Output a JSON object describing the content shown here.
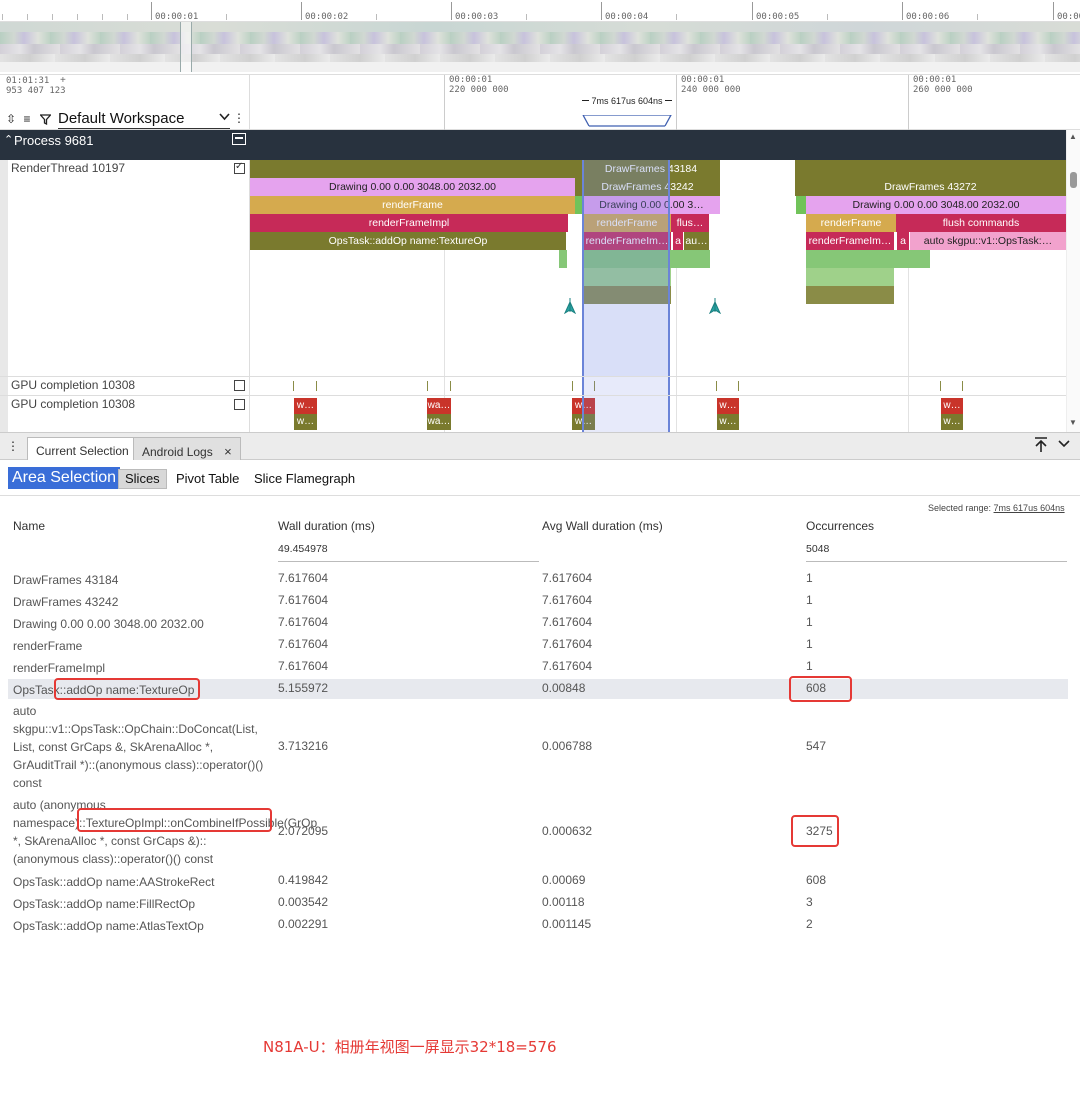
{
  "overview": {
    "time_labels": [
      "00:00:01",
      "00:00:02",
      "00:00:03",
      "00:00:04",
      "00:00:05",
      "00:00:06",
      "00:00"
    ]
  },
  "header": {
    "origin_time": "01:01:31",
    "origin_ns": "953 407 123",
    "plus": "+",
    "workspace": "Default Workspace",
    "time_marks": [
      {
        "t": "00:00:01",
        "ns": "220 000 000"
      },
      {
        "t": "00:00:01",
        "ns": "240 000 000"
      },
      {
        "t": "00:00:01",
        "ns": "260 000 000"
      }
    ],
    "selection_label": "7ms 617us 604ns"
  },
  "process": {
    "title": "Process 9681"
  },
  "tracks": {
    "render_thread": "RenderThread 10197",
    "gpu1": "GPU completion 10308",
    "gpu2": "GPU completion 10308"
  },
  "slices": {
    "drawframes_a": "DrawFrames 43184",
    "drawframes_b": "DrawFrames 43242",
    "drawframes_c": "DrawFrames 43272",
    "drawing_a": "Drawing  0.00  0.00 3048.00 2032.00",
    "drawing_b": "Drawing  0.00  0.00 3…",
    "drawing_c": "Drawing  0.00  0.00 3048.00 2032.00",
    "renderframe": "renderFrame",
    "renderframe_impl": "renderFrameImpl",
    "renderframe_impl_short": "renderFrameIm…",
    "flush": "flus…",
    "flush_commands": "flush commands",
    "opstask": "OpsTask::addOp name:TextureOp",
    "a": "a",
    "au": "au…",
    "auto_skgpu": "auto skgpu::v1::OpsTask:…",
    "gpu_w": "w…",
    "gpu_wa": "wa…"
  },
  "panel": {
    "tab_current": "Current Selection",
    "tab_logs": "Android Logs",
    "close": "×"
  },
  "area": {
    "title": "Area Selection",
    "tabs": [
      "Slices",
      "Pivot Table",
      "Slice Flamegraph"
    ],
    "range_prefix": "Selected range: ",
    "range_value": "7ms 617us 604ns"
  },
  "table": {
    "columns": [
      "Name",
      "Wall duration (ms)",
      "Avg Wall duration (ms)",
      "Occurrences"
    ],
    "totals": {
      "wall": "49.454978",
      "occ": "5048"
    },
    "rows": [
      {
        "name": "DrawFrames 43184",
        "wall": "7.617604",
        "avg": "7.617604",
        "occ": "1"
      },
      {
        "name": "DrawFrames 43242",
        "wall": "7.617604",
        "avg": "7.617604",
        "occ": "1"
      },
      {
        "name": "Drawing 0.00 0.00 3048.00 2032.00",
        "wall": "7.617604",
        "avg": "7.617604",
        "occ": "1"
      },
      {
        "name": "renderFrame",
        "wall": "7.617604",
        "avg": "7.617604",
        "occ": "1"
      },
      {
        "name": "renderFrameImpl",
        "wall": "7.617604",
        "avg": "7.617604",
        "occ": "1"
      },
      {
        "name": "OpsTask::addOp name:TextureOp",
        "wall": "5.155972",
        "avg": "0.00848",
        "occ": "608"
      },
      {
        "name": "auto skgpu::v1::OpsTask::OpChain::DoConcat(List, List, const GrCaps &, SkArenaAlloc *, GrAuditTrail *)::(anonymous class)::operator()() const",
        "wall": "3.713216",
        "avg": "0.006788",
        "occ": "547"
      },
      {
        "name": "auto (anonymous namespace)::TextureOpImpl::onCombineIfPossible(GrOp *, SkArenaAlloc *, const GrCaps &)::(anonymous class)::operator()() const",
        "wall": "2.072095",
        "avg": "0.000632",
        "occ": "3275"
      },
      {
        "name": "OpsTask::addOp name:AAStrokeRect",
        "wall": "0.419842",
        "avg": "0.00069",
        "occ": "608"
      },
      {
        "name": "OpsTask::addOp name:FillRectOp",
        "wall": "0.003542",
        "avg": "0.00118",
        "occ": "3"
      },
      {
        "name": "OpsTask::addOp name:AtlasTextOp",
        "wall": "0.002291",
        "avg": "0.001145",
        "occ": "2"
      }
    ]
  },
  "footnote": "N81A-U：相册年视图一屏显示32*18=576"
}
